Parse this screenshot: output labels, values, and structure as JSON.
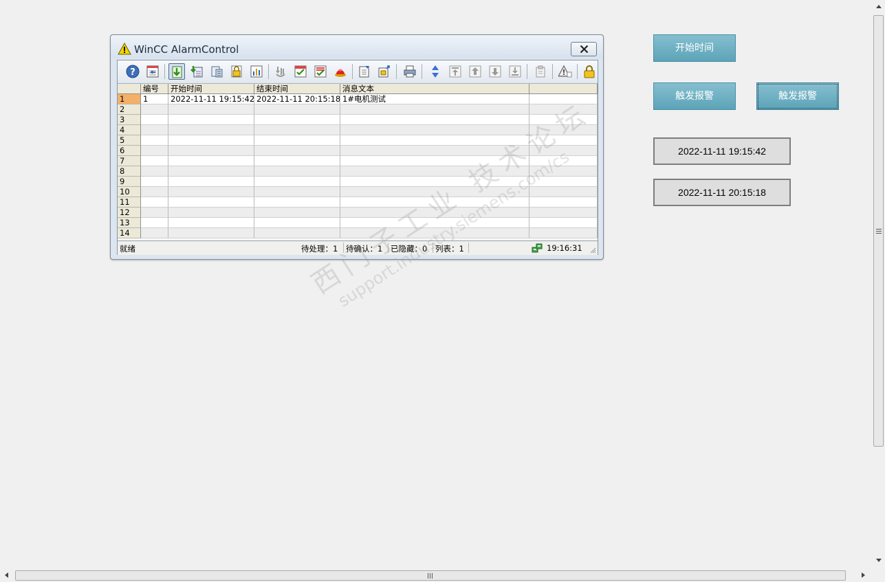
{
  "window": {
    "title": "WinCC AlarmControl"
  },
  "table": {
    "headers": [
      "编号",
      "开始时间",
      "结束时间",
      "消息文本",
      ""
    ],
    "row_numbers": [
      "1",
      "2",
      "3",
      "4",
      "5",
      "6",
      "7",
      "8",
      "9",
      "10",
      "11",
      "12",
      "13",
      "14"
    ],
    "rows": [
      [
        "1",
        "2022-11-11 19:15:42",
        "2022-11-11 20:15:18",
        "1#电机测试",
        ""
      ]
    ],
    "selected_row": 1
  },
  "statusbar": {
    "status": "就绪",
    "pending_label": "待处理：",
    "pending_value": "1",
    "unack_label": "待确认：",
    "unack_value": "1",
    "hidden_label": "已隐藏：",
    "hidden_value": "0",
    "list_label": "列表：",
    "list_value": "1",
    "clock": "19:16:31"
  },
  "buttons": {
    "start_time": "开始时间",
    "trigger_alarm_1": "触发报警",
    "trigger_alarm_2": "触发报警"
  },
  "time_fields": {
    "start": "2022-11-11 19:15:42",
    "end": "2022-11-11 20:15:18"
  },
  "watermark": {
    "cn": "西门子工业 技术论坛",
    "en": "support.industry.siemens.com/cs"
  },
  "icons": [
    "help-icon",
    "emergency-list-icon",
    "message-list-icon",
    "history-list-icon",
    "journal-list-icon",
    "lock-list-icon",
    "hitlist-icon",
    "loop-in-alarm-icon",
    "single-ack-icon",
    "group-ack-icon",
    "emergency-ack-icon",
    "selection-dialog-icon",
    "display-options-icon",
    "print-icon",
    "sort-icon",
    "first-message-icon",
    "previous-message-icon",
    "next-message-icon",
    "last-message-icon",
    "comment-icon",
    "info-text-icon",
    "autoscroll-lock-icon"
  ]
}
